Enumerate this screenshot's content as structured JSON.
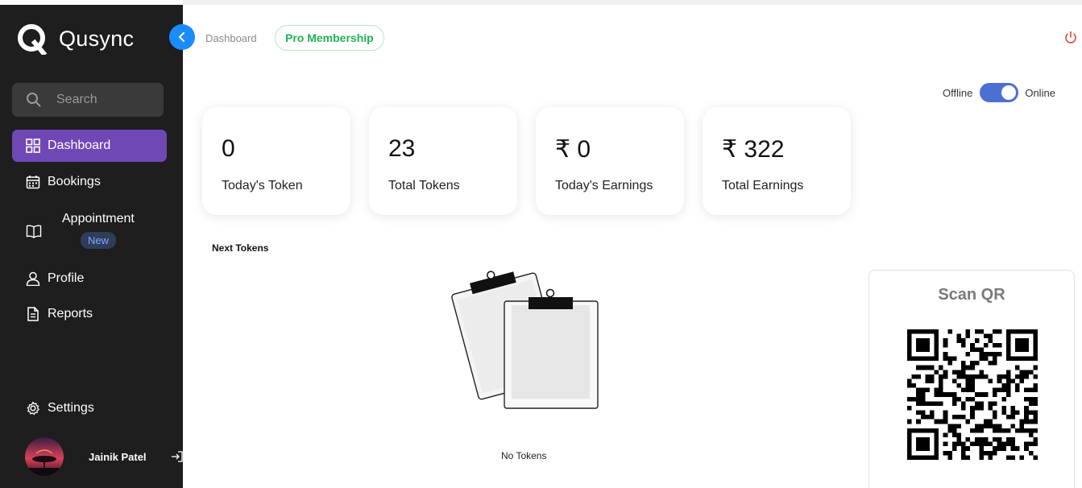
{
  "app": {
    "name": "Qusync"
  },
  "search": {
    "placeholder": "Search"
  },
  "nav": {
    "dashboard": "Dashboard",
    "bookings": "Bookings",
    "appointment": "Appointment",
    "appointment_badge": "New",
    "profile": "Profile",
    "reports": "Reports",
    "settings": "Settings"
  },
  "user": {
    "name": "Jainik Patel"
  },
  "header": {
    "breadcrumb": "Dashboard",
    "membership": "Pro Membership"
  },
  "status": {
    "offline_label": "Offline",
    "online_label": "Online",
    "is_online": true
  },
  "stats": [
    {
      "value": "0",
      "label": "Today's Token"
    },
    {
      "value": "23",
      "label": "Total Tokens"
    },
    {
      "value": "₹ 0",
      "label": "Today's Earnings"
    },
    {
      "value": "₹ 322",
      "label": "Total Earnings"
    }
  ],
  "next_tokens": {
    "title": "Next Tokens",
    "empty_text": "No Tokens"
  },
  "qr": {
    "title": "Scan QR"
  },
  "colors": {
    "sidebar": "#1e1e1e",
    "active_nav": "#7048b6",
    "accent_blue": "#1a8cff",
    "pro_green": "#22b35a",
    "toggle": "#4c6fd4"
  }
}
